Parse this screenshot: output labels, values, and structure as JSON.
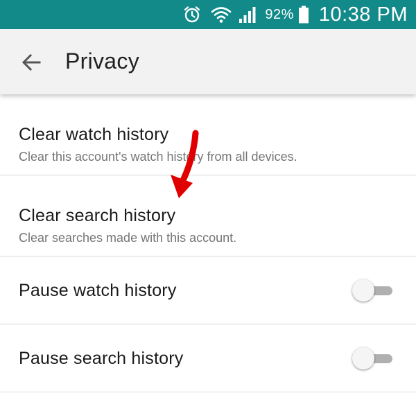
{
  "status_bar": {
    "battery_percent": "92%",
    "time": "10:38 PM",
    "icons": [
      "alarm-icon",
      "wifi-icon",
      "signal-icon",
      "battery-icon"
    ],
    "background_color": "#138a8a"
  },
  "app_bar": {
    "title": "Privacy",
    "back_icon": "arrow-left-icon"
  },
  "settings": {
    "clear_watch": {
      "title": "Clear watch history",
      "subtitle": "Clear this account's watch history from all devices."
    },
    "clear_search": {
      "title": "Clear search history",
      "subtitle": "Clear searches made with this account."
    },
    "pause_watch": {
      "title": "Pause watch history",
      "enabled": false
    },
    "pause_search": {
      "title": "Pause search history",
      "enabled": false
    }
  },
  "annotation": {
    "type": "red-arrow",
    "color": "#e00000",
    "points_to": "Clear search history"
  }
}
